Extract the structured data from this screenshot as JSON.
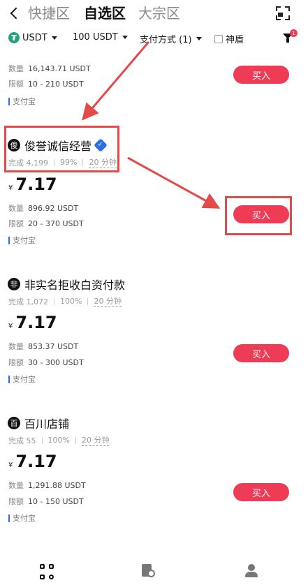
{
  "header": {
    "tabs": [
      {
        "label": "快捷区",
        "active": false
      },
      {
        "label": "自选区",
        "active": true
      },
      {
        "label": "大宗区",
        "active": false
      }
    ]
  },
  "filters": {
    "currency": "USDT",
    "amount": "100 USDT",
    "payment": "支付方式 (1)",
    "shield_label": "神盾",
    "filter_badge": "1"
  },
  "listings": [
    {
      "merchant": "",
      "completed": "",
      "rate": "",
      "time": "",
      "price": "",
      "quantity_label": "数量",
      "quantity": "16,143.71 USDT",
      "limit_label": "限额",
      "limit": "10 - 210 USDT",
      "payment": "支付宝",
      "buy_label": "买入"
    },
    {
      "merchant": "俊誉诚信经营",
      "avatar": "俊",
      "verified": true,
      "completed": "完成 4,199",
      "rate": "99%",
      "time": "20 分钟",
      "currency_symbol": "¥",
      "price": "7.17",
      "quantity_label": "数量",
      "quantity": "896.92 USDT",
      "limit_label": "限额",
      "limit": "20 - 370 USDT",
      "payment": "支付宝",
      "buy_label": "买入"
    },
    {
      "merchant": "非实名拒收白资付款",
      "avatar": "非",
      "completed": "完成 1,072",
      "rate": "100%",
      "time": "20 分钟",
      "currency_symbol": "¥",
      "price": "7.17",
      "quantity_label": "数量",
      "quantity": "853.37 USDT",
      "limit_label": "限额",
      "limit": "30 - 300 USDT",
      "payment": "支付宝",
      "buy_label": "买入"
    },
    {
      "merchant": "百川店铺",
      "avatar": "百",
      "completed": "完成 55",
      "rate": "100%",
      "time": "20 分钟",
      "currency_symbol": "¥",
      "price": "7.17",
      "quantity_label": "数量",
      "quantity": "1,291.88 USDT",
      "limit_label": "限额",
      "limit": "10 - 150 USDT",
      "payment": "支付宝",
      "buy_label": "买入"
    }
  ],
  "colors": {
    "buy_button": "#ef3c56",
    "annotation": "#e34a4a",
    "verified": "#2d6fe0",
    "tether": "#26a17b"
  },
  "icons": {
    "back": "chevron-left-icon",
    "scan": "scan-icon",
    "filter": "funnel-icon",
    "nav": [
      "home-grid-icon",
      "order-icon",
      "user-icon"
    ]
  }
}
